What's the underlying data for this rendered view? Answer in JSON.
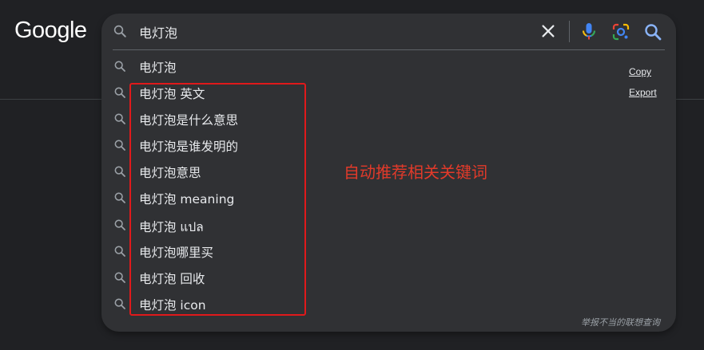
{
  "logo": {
    "text": "Google"
  },
  "search": {
    "query": "电灯泡",
    "clear_icon": "close-icon",
    "voice_icon": "microphone-icon",
    "lens_icon": "lens-camera-icon",
    "submit_icon": "search-icon"
  },
  "suggestions": [
    "电灯泡",
    "电灯泡 英文",
    "电灯泡是什么意思",
    "电灯泡是谁发明的",
    "电灯泡意思",
    "电灯泡 meaning",
    "电灯泡 แปล",
    "电灯泡哪里买",
    "电灯泡 回收",
    "电灯泡 icon"
  ],
  "side_links": {
    "copy": "Copy",
    "export": "Export"
  },
  "footer": {
    "report": "举报不当的联想查询"
  },
  "annotation": {
    "text": "自动推荐相关关键词"
  },
  "colors": {
    "background": "#202124",
    "panel": "#303134",
    "text": "#e8eaed",
    "annotation_red": "#e0191b",
    "mic_blue": "#4285f4",
    "mic_red": "#ea4335",
    "search_blue": "#8ab4f8"
  }
}
